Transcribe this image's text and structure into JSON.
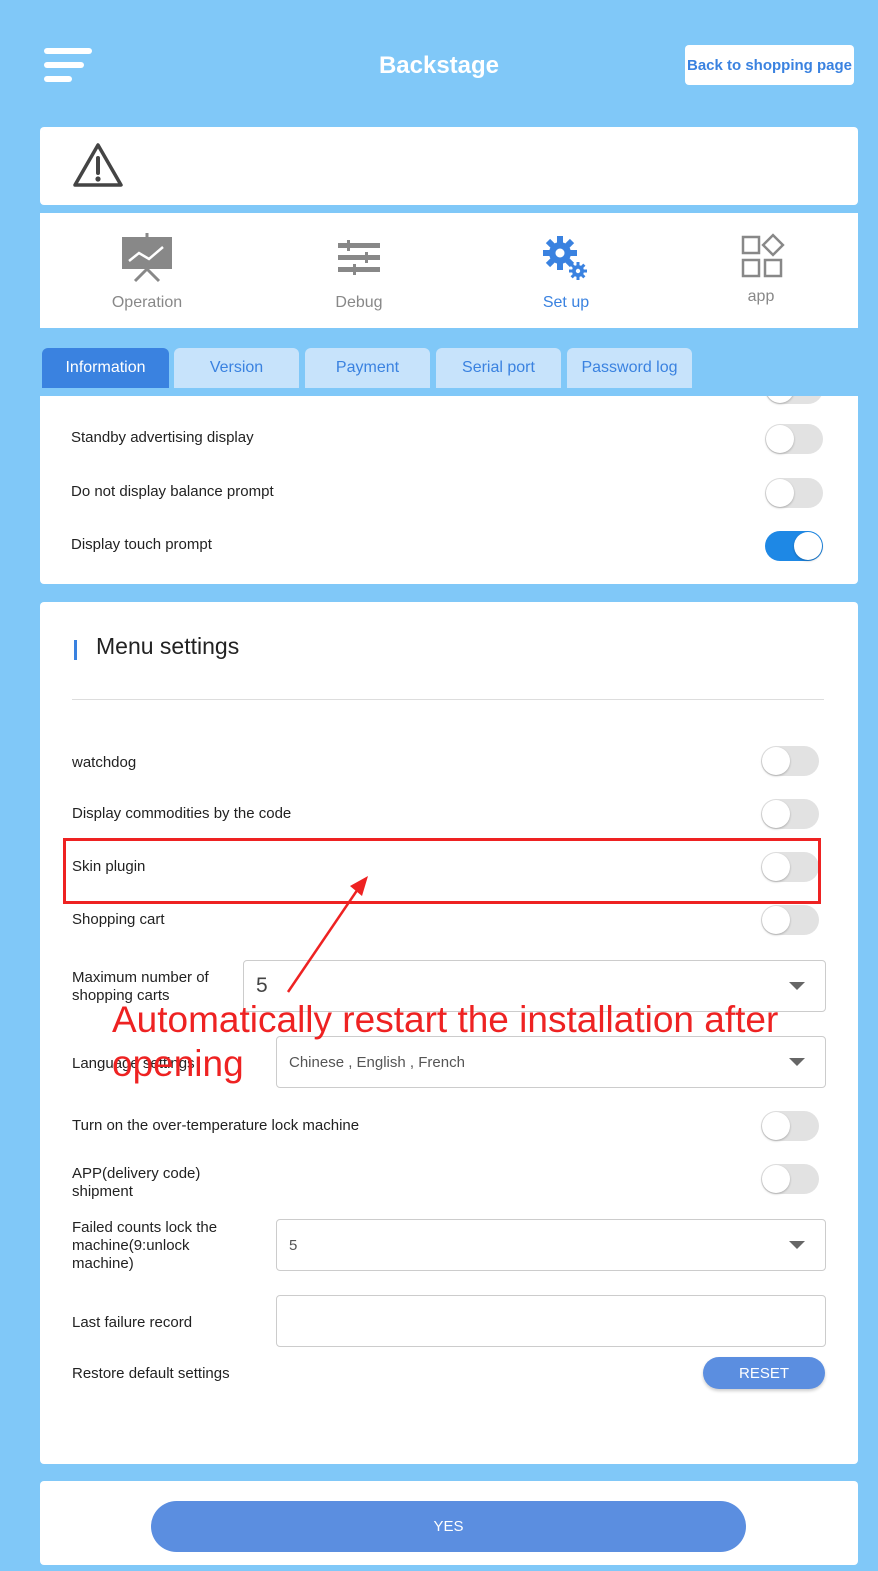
{
  "header": {
    "title": "Backstage",
    "back_button": "Back to shopping page"
  },
  "warning": {
    "icon": "warning-triangle-icon"
  },
  "nav": [
    {
      "label": "Operation",
      "icon": "presentation-chart-icon",
      "active": false
    },
    {
      "label": "Debug",
      "icon": "sliders-icon",
      "active": false
    },
    {
      "label": "Set up",
      "icon": "gears-icon",
      "active": true
    },
    {
      "label": "app",
      "icon": "app-grid-icon",
      "active": false
    }
  ],
  "tabs": [
    {
      "label": "Information",
      "active": true
    },
    {
      "label": "Version",
      "active": false
    },
    {
      "label": "Payment",
      "active": false
    },
    {
      "label": "Serial port",
      "active": false
    },
    {
      "label": "Password log",
      "active": false
    }
  ],
  "info_settings": [
    {
      "label": "Standby advertising display",
      "on": false
    },
    {
      "label": "Do not display balance prompt",
      "on": false
    },
    {
      "label": "Display touch prompt",
      "on": true
    }
  ],
  "menu_settings": {
    "title": "Menu settings",
    "watchdog": {
      "label": "watchdog",
      "on": false
    },
    "display_by_code": {
      "label": "Display commodities by the code",
      "on": false
    },
    "skin_plugin": {
      "label": "Skin plugin",
      "on": false
    },
    "shopping_cart": {
      "label": "Shopping cart",
      "on": false
    },
    "max_carts": {
      "label": "Maximum number of shopping carts",
      "value": "5"
    },
    "language": {
      "label": "Language settings",
      "value": "Chinese , English , French"
    },
    "over_temp": {
      "label": "Turn on the over-temperature lock machine",
      "on": false
    },
    "app_shipment": {
      "label": "APP(delivery code) shipment",
      "on": false
    },
    "failed_counts": {
      "label": "Failed counts lock the machine(9:unlock machine)",
      "value": "5"
    },
    "last_failure": {
      "label": "Last failure record",
      "value": ""
    },
    "restore": {
      "label": "Restore default settings",
      "button": "RESET"
    }
  },
  "annotation": {
    "text": "Automatically restart the installation after opening",
    "color": "#ee2222"
  },
  "footer": {
    "confirm_button": "YES"
  },
  "colors": {
    "background": "#80c8f8",
    "accent": "#3a82e0",
    "toggle_on": "#1e88e5"
  }
}
